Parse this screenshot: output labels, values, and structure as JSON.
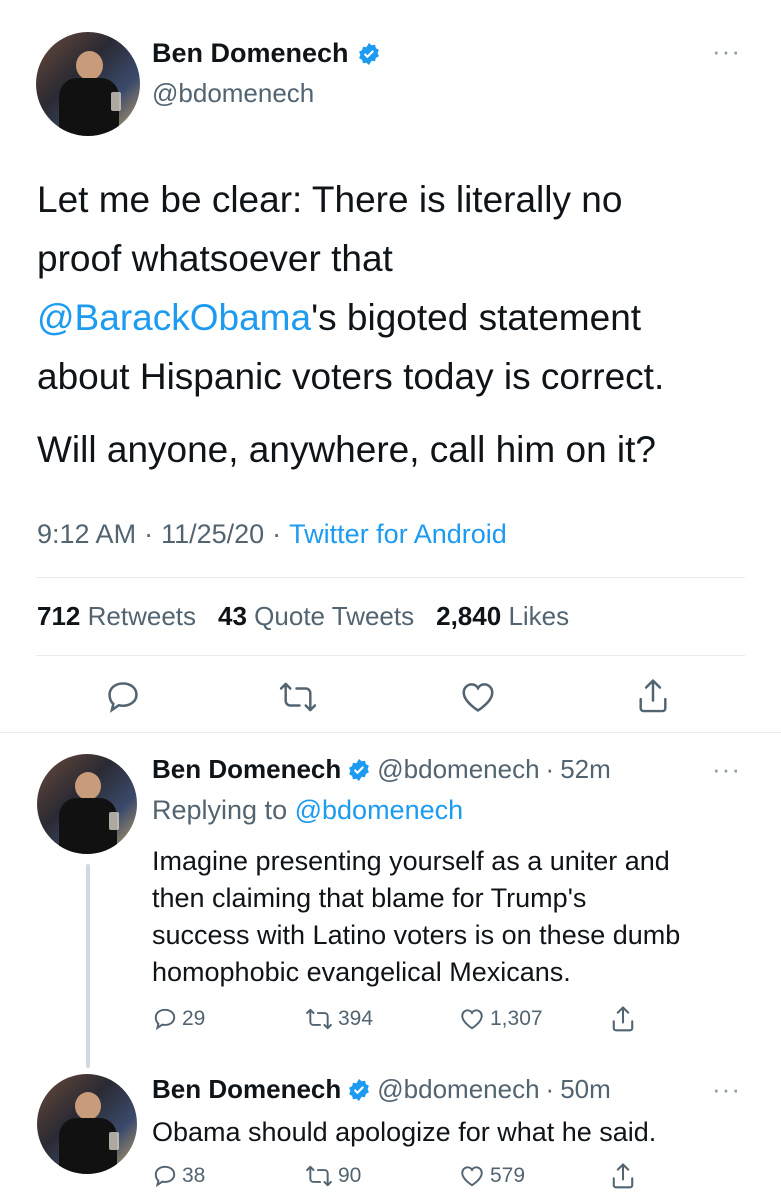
{
  "main_tweet": {
    "author_name": "Ben Domenech",
    "author_handle": "@bdomenech",
    "text_line1": "Let me be clear: There is literally no",
    "text_line2": "proof whatsoever that",
    "mention": "@BarackObama",
    "text_line3_rest": "'s bigoted statement",
    "text_line4": "about Hispanic voters today is correct.",
    "text_line5": "Will anyone, anywhere, call him on it?",
    "time": "9:12 AM",
    "sep1": "·",
    "date": "11/25/20",
    "sep2": "·",
    "source": "Twitter for Android",
    "retweets_count": "712",
    "retweets_label": "Retweets",
    "quotes_count": "43",
    "quotes_label": "Quote Tweets",
    "likes_count": "2,840",
    "likes_label": "Likes"
  },
  "reply1": {
    "author_name": "Ben Domenech",
    "author_handle": "@bdomenech",
    "sep": "·",
    "time": "52m",
    "replying_prefix": "Replying to",
    "replying_handle": "@bdomenech",
    "line1": "Imagine presenting yourself as a uniter and",
    "line2": "then claiming that blame for Trump's",
    "line3": "success with Latino voters is on these dumb",
    "line4": "homophobic evangelical Mexicans.",
    "replies": "29",
    "retweets": "394",
    "likes": "1,307"
  },
  "reply2": {
    "author_name": "Ben Domenech",
    "author_handle": "@bdomenech",
    "sep": "·",
    "time": "50m",
    "line1": "Obama should apologize for what he said.",
    "replies": "38",
    "retweets": "90",
    "likes": "579"
  },
  "icons": {
    "more": "···",
    "verified": "verified-badge-icon",
    "reply": "reply-icon",
    "retweet": "retweet-icon",
    "like": "heart-icon",
    "share": "share-icon"
  },
  "colors": {
    "link": "#1d9bf0",
    "text": "#0f1419",
    "muted": "#536471",
    "divider": "#e6ecf0"
  }
}
